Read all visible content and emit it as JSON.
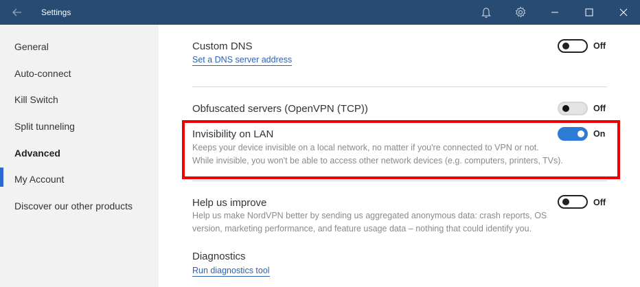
{
  "titlebar": {
    "title": "Settings",
    "icons": [
      "back-arrow",
      "bell",
      "gear",
      "minimize",
      "maximize",
      "close"
    ]
  },
  "sidebar": {
    "items": [
      {
        "label": "General"
      },
      {
        "label": "Auto-connect"
      },
      {
        "label": "Kill Switch"
      },
      {
        "label": "Split tunneling"
      },
      {
        "label": "Advanced",
        "active": true
      },
      {
        "label": "My Account"
      },
      {
        "label": "Discover our other products"
      }
    ]
  },
  "main": {
    "custom_dns": {
      "title": "Custom DNS",
      "link": "Set a DNS server address",
      "state": "Off"
    },
    "obfuscated": {
      "title": "Obfuscated servers (OpenVPN (TCP))",
      "state": "Off"
    },
    "invisibility": {
      "title": "Invisibility on LAN",
      "desc1": "Keeps your device invisible on a local network, no matter if you're connected to VPN or not.",
      "desc2": "While invisible, you won't be able to access other network devices (e.g. computers, printers, TVs).",
      "state": "On"
    },
    "help_improve": {
      "title": "Help us improve",
      "desc1": "Help us make NordVPN better by sending us aggregated anonymous data: crash reports, OS",
      "desc2": "version, marketing performance, and feature usage data – nothing that could identify you.",
      "state": "Off"
    },
    "diagnostics": {
      "title": "Diagnostics",
      "link": "Run diagnostics tool"
    }
  },
  "colors": {
    "titlebar": "#284b73",
    "accent": "#2e7bd6",
    "highlight": "#ee0000",
    "link": "#2a62b8"
  }
}
